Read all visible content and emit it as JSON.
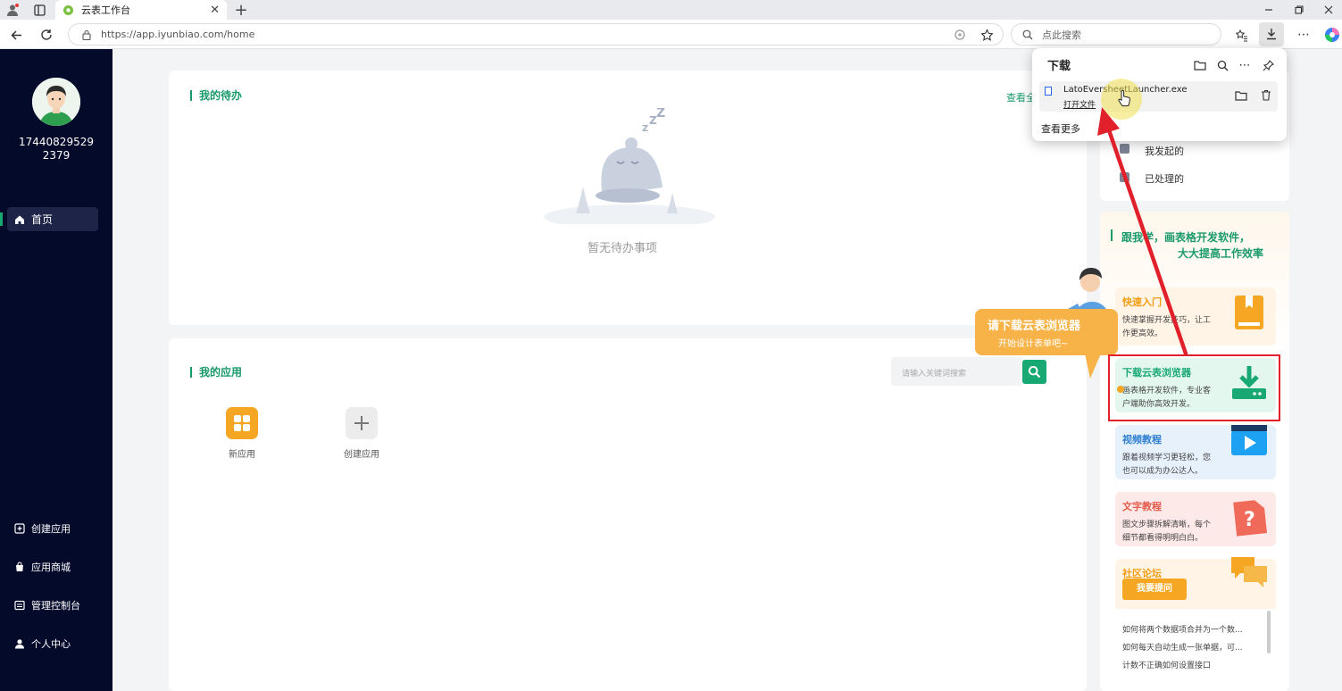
{
  "browser": {
    "tab_title": "云表工作台",
    "url": "https://app.iyunbiao.com/home",
    "search_placeholder": "点此搜索"
  },
  "downloads": {
    "title": "下载",
    "file_name": "LatoEversheetLauncher.exe",
    "open_file": "打开文件",
    "see_more": "查看更多"
  },
  "sidebar": {
    "user_id_line1": "17440829529",
    "user_id_line2": "2379",
    "home": "首页",
    "items": [
      {
        "label": "创建应用"
      },
      {
        "label": "应用商城"
      },
      {
        "label": "管理控制台"
      },
      {
        "label": "个人中心"
      }
    ]
  },
  "todo": {
    "title": "我的待办",
    "view_all": "查看全",
    "empty": "暂无待办事项"
  },
  "apps": {
    "title": "我的应用",
    "search_placeholder": "请输入关键词搜索",
    "items": [
      {
        "label": "新应用"
      },
      {
        "label": "创建应用"
      }
    ]
  },
  "right_panel": {
    "initiated": "我发起的",
    "processed": "已处理的",
    "slogan_line1": "跟我学，画表格开发软件，",
    "slogan_line2": "大大提高工作效率",
    "bubble_line1": "请下载云表浏览器",
    "bubble_line2": "开始设计表单吧~",
    "cards": [
      {
        "title": "快速入门",
        "desc": "快速掌握开发技巧，让工作更高效。",
        "color": "#f39c12"
      },
      {
        "title": "下载云表浏览器",
        "desc": "画表格开发软件，专业客户端助你高效开发。",
        "color": "#18a874"
      },
      {
        "title": "视频教程",
        "desc": "跟着视频学习更轻松，您也可以成为办公达人。",
        "color": "#2f80d1"
      },
      {
        "title": "文字教程",
        "desc": "图文步骤拆解清晰，每个细节都看得明明白白。",
        "color": "#e55b4d"
      },
      {
        "title": "社区论坛",
        "desc": "",
        "color": "#f39c12"
      }
    ],
    "ask_button": "我要提问",
    "forum_posts": [
      "如何将两个数据项合并为一个数...",
      "如何每天自动生成一张单据，可...",
      "计数不正确如何设置接口"
    ]
  },
  "colors": {
    "accent": "#18a874",
    "sidebar_bg": "#030a2a",
    "highlight": "#e0202a"
  }
}
